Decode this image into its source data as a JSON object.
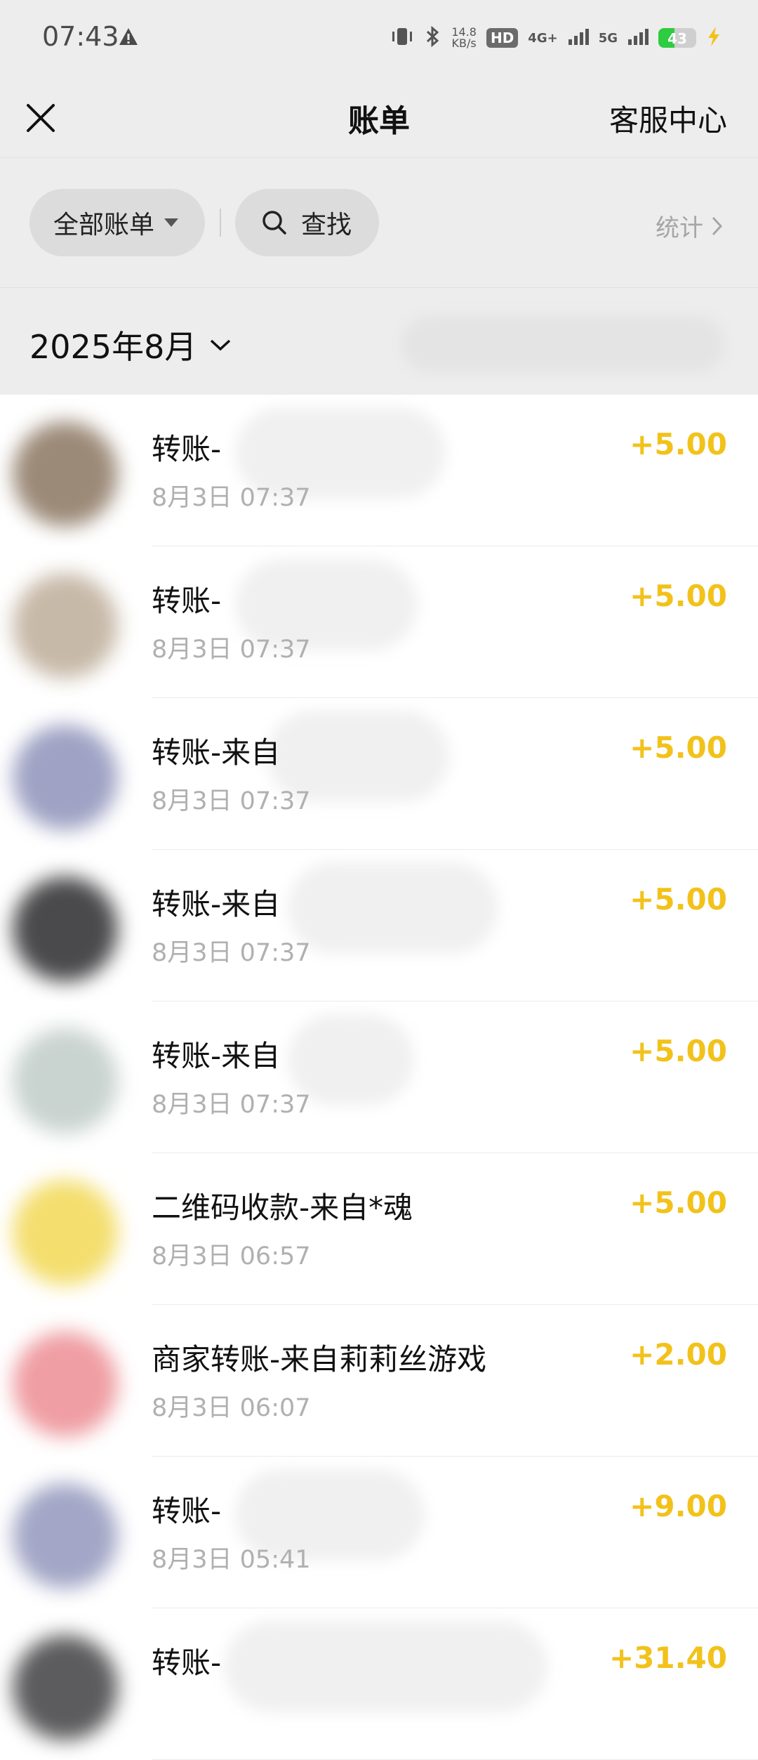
{
  "status_bar": {
    "time": "07:43",
    "speed_value": "14.8",
    "speed_unit": "KB/s",
    "hd_label": "HD",
    "net1": "4G+",
    "net2": "5G",
    "battery_percent": "43",
    "battery_level": 0.43,
    "battery_color": "#2ecc40"
  },
  "nav": {
    "title": "账单",
    "service_label": "客服中心"
  },
  "filters": {
    "all_bills_label": "全部账单",
    "search_label": "查找",
    "stats_label": "统计"
  },
  "month": {
    "label": "2025年8月"
  },
  "colors": {
    "amount": "#f2c21b",
    "background": "#ededed"
  },
  "transactions": [
    {
      "title": "转账-",
      "time": "8月3日 07:37",
      "amount": "+5.00"
    },
    {
      "title": "转账-",
      "time": "8月3日 07:37",
      "amount": "+5.00"
    },
    {
      "title": "转账-来自",
      "time": "8月3日 07:37",
      "amount": "+5.00"
    },
    {
      "title": "转账-来自",
      "time": "8月3日 07:37",
      "amount": "+5.00"
    },
    {
      "title": "转账-来自",
      "time": "8月3日 07:37",
      "amount": "+5.00"
    },
    {
      "title": "二维码收款-来自*魂",
      "time": "8月3日 06:57",
      "amount": "+5.00"
    },
    {
      "title": "商家转账-来自莉莉丝游戏",
      "time": "8月3日 06:07",
      "amount": "+2.00"
    },
    {
      "title": "转账-",
      "time": "8月3日 05:41",
      "amount": "+9.00"
    },
    {
      "title": "转账-",
      "time": "",
      "amount": "+31.40"
    }
  ]
}
